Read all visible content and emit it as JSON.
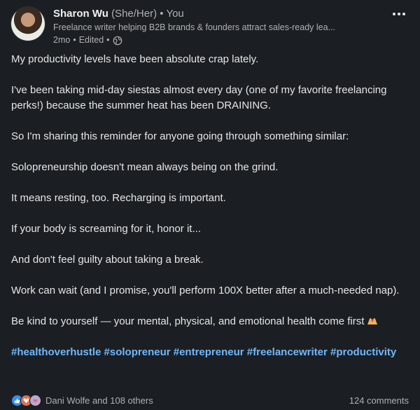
{
  "post": {
    "author": {
      "name": "Sharon Wu",
      "pronouns": "(She/Her)",
      "separator": "•",
      "relation": "You",
      "headline": "Freelance writer helping B2B brands & founders attract sales-ready lea...",
      "age": "2mo",
      "edited": "Edited",
      "visibility_icon": "globe-icon"
    },
    "menu_icon": "more-options-icon",
    "body": {
      "paragraphs": [
        "My productivity levels have been absolute crap lately.",
        "I've been taking mid-day siestas almost every day (one of my favorite freelancing perks!) because the summer heat has been DRAINING.",
        "So I'm sharing this reminder for anyone going through something similar:",
        "Solopreneurship doesn't mean always being on the grind.",
        "It means resting, too. Recharging is important.",
        "If your body is screaming for it, honor it...",
        "And don't feel guilty about taking a break.",
        "Work can wait (and I promise, you'll perform 100X better after a much-needed nap).",
        "Be kind to yourself — your mental, physical, and emotional health come first"
      ],
      "closing_emoji": "hands-heart-icon",
      "hashtags": [
        "#healthoverhustle",
        "#solopreneur",
        "#entrepreneur",
        "#freelancewriter",
        "#productivity"
      ]
    },
    "footer": {
      "reaction_icons": [
        "like-icon",
        "love-icon",
        "support-icon"
      ],
      "reactors": "Dani Wolfe and 108 others",
      "comments": "124 comments"
    }
  },
  "colors": {
    "background": "#1b1f23",
    "hashtag": "#71b7fb",
    "secondary_text": "#b0b0b0"
  }
}
